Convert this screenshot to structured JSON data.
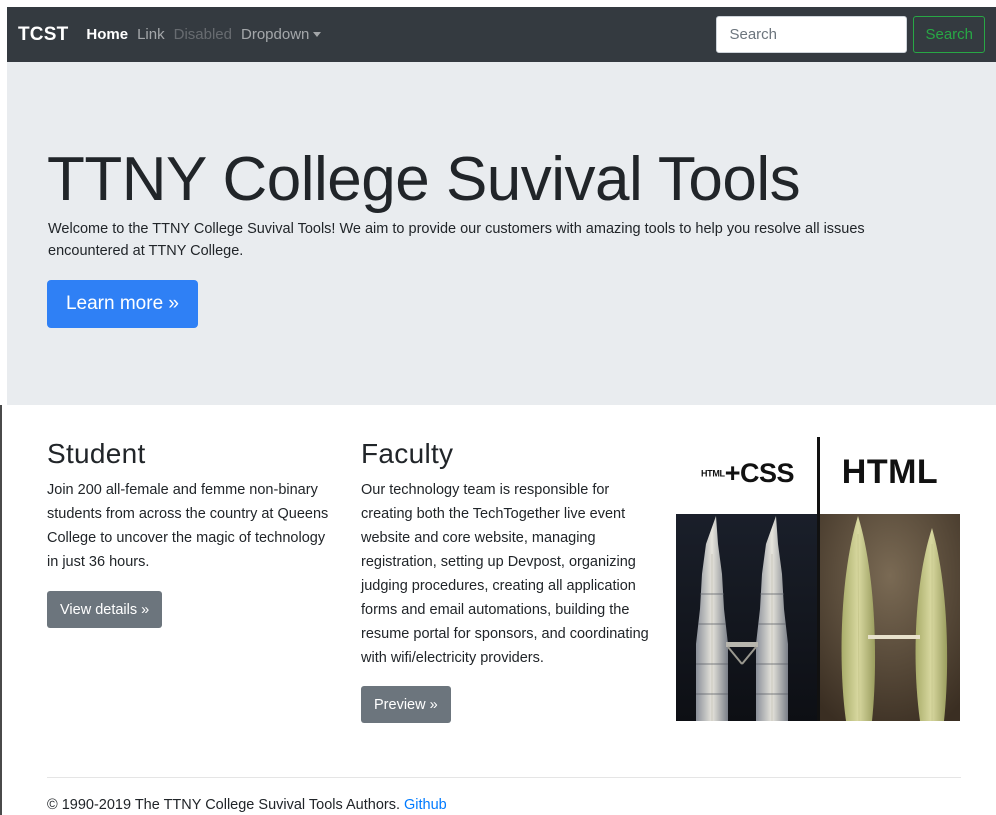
{
  "navbar": {
    "brand": "TCST",
    "links": [
      {
        "label": "Home"
      },
      {
        "label": "Link"
      },
      {
        "label": "Disabled"
      },
      {
        "label": "Dropdown"
      }
    ],
    "search_placeholder": "Search",
    "search_button": "Search"
  },
  "jumbotron": {
    "title": "TTNY College Suvival Tools",
    "lead": "Welcome to the TTNY College Suvival Tools! We aim to provide our customers with amazing tools to help you resolve all issues encountered at TTNY College.",
    "button": "Learn more »"
  },
  "student": {
    "heading": "Student",
    "text": "Join 200 all-female and femme non-binary students from across the country at Queens College to uncover the magic of technology in just 36 hours.",
    "button": "View details »"
  },
  "faculty": {
    "heading": "Faculty",
    "text": "Our technology team is responsible for creating both the TechTogether live event website and core website, managing registration, setting up Devpost, organizing judging procedures, creating all application forms and email automations, building the resume portal for sponsors, and coordinating with wifi/electricity providers.",
    "button": "Preview »"
  },
  "meme": {
    "left_small": "HTML",
    "left_big": "+CSS",
    "right": "HTML"
  },
  "footer": {
    "text": "© 1990-2019 The TTNY College Suvival Tools Authors. ",
    "link": "Github"
  },
  "colors": {
    "navbar_bg": "#343a40",
    "jumbotron_bg": "#e9ecef",
    "primary": "#2f80f5",
    "secondary": "#6c757d",
    "success": "#28a745",
    "link": "#007bff"
  }
}
